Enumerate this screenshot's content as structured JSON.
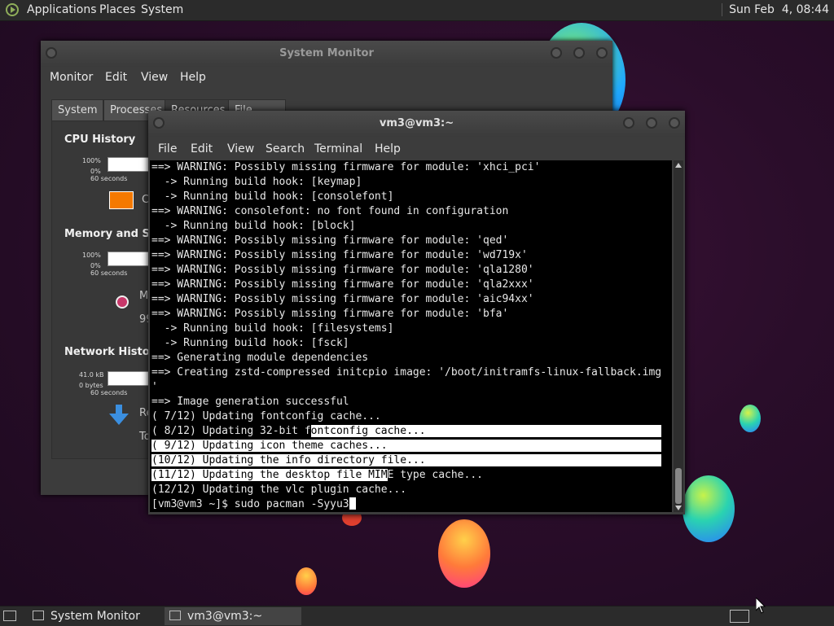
{
  "top_panel": {
    "menus": [
      "Applications",
      "Places",
      "System"
    ],
    "clock": "Sun Feb  4, 08:44",
    "logo_icon": "distro-logo-icon"
  },
  "system_monitor": {
    "title": "System Monitor",
    "menus": [
      "Monitor",
      "Edit",
      "View",
      "Help"
    ],
    "tabs": [
      "System",
      "Processes",
      "Resources",
      "File Systems"
    ],
    "active_tab": "Resources",
    "cpu": {
      "heading": "CPU History",
      "ymax": "100%",
      "ymin": "0%",
      "xlabel": "60 seconds",
      "legend_partial": "C",
      "swatch_color": "#f57900"
    },
    "memory": {
      "heading": "Memory and Swa",
      "ymax": "100%",
      "ymin": "0%",
      "xlabel": "60 seconds",
      "label_partial": "M",
      "value_partial": "99"
    },
    "network": {
      "heading": "Network History",
      "ymax": "41.0 kB",
      "ymin": "0 bytes",
      "xlabel": "60 seconds",
      "receiving_partial": "Re",
      "total_partial": "To"
    }
  },
  "terminal": {
    "title": "vm3@vm3:~",
    "menus": [
      "File",
      "Edit",
      "View",
      "Search",
      "Terminal",
      "Help"
    ],
    "lines": [
      "==> WARNING: Possibly missing firmware for module: 'xhci_pci'",
      "  -> Running build hook: [keymap]",
      "  -> Running build hook: [consolefont]",
      "==> WARNING: consolefont: no font found in configuration",
      "  -> Running build hook: [block]",
      "==> WARNING: Possibly missing firmware for module: 'qed'",
      "==> WARNING: Possibly missing firmware for module: 'wd719x'",
      "==> WARNING: Possibly missing firmware for module: 'qla1280'",
      "==> WARNING: Possibly missing firmware for module: 'qla2xxx'",
      "==> WARNING: Possibly missing firmware for module: 'aic94xx'",
      "==> WARNING: Possibly missing firmware for module: 'bfa'",
      "  -> Running build hook: [filesystems]",
      "  -> Running build hook: [fsck]",
      "==> Generating module dependencies",
      "==> Creating zstd-compressed initcpio image: '/boot/initramfs-linux-fallback.img",
      "'",
      "==> Image generation successful",
      "( 7/12) Updating fontconfig cache...",
      "( 8/12) Updating 32-bit fontconfig cache...",
      "( 9/12) Updating icon theme caches...",
      "(10/12) Updating the info directory file...",
      "(11/12) Updating the desktop file MIME type cache...",
      "(12/12) Updating the vlc plugin cache..."
    ],
    "prompt": "[vm3@vm3 ~]$ sudo pacman -Syyu3"
  },
  "taskbar": {
    "tasks": [
      "System Monitor",
      "vm3@vm3:~"
    ],
    "active_task": "vm3@vm3:~"
  },
  "colors": {
    "panel": "#2b2b2b",
    "terminal_bg": "#000000",
    "accent_orange": "#f57900"
  }
}
